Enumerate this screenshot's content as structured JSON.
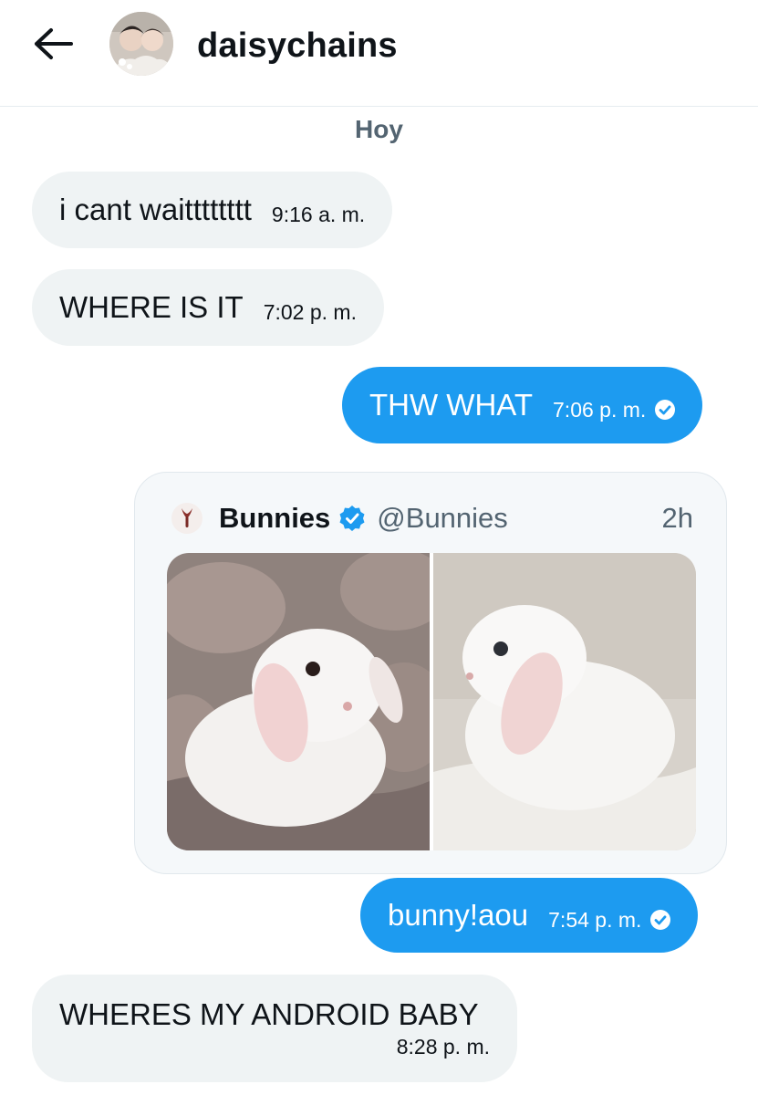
{
  "header": {
    "title": "daisychains",
    "back_icon": "arrow-left-icon"
  },
  "conversation": {
    "day_label": "Hoy",
    "messages": [
      {
        "text": "i cant waitttttttt",
        "time": "9:16 a. m.",
        "direction": "incoming"
      },
      {
        "text": "WHERE IS IT",
        "time": "7:02 p. m.",
        "direction": "incoming"
      },
      {
        "text": "THW WHAT",
        "time": "7:06 p. m.",
        "direction": "outgoing",
        "status_icon": "read-check-icon"
      },
      {
        "text": "bunny!aou",
        "time": "7:54 p. m.",
        "direction": "outgoing",
        "status_icon": "read-check-icon"
      },
      {
        "text": "WHERES MY ANDROID BABY",
        "time": "8:28 p. m.",
        "direction": "incoming"
      }
    ]
  },
  "quoted_post": {
    "name": "Bunnies",
    "handle": "@Bunnies",
    "age": "2h",
    "verified_icon": "verified-badge-icon",
    "photo_count": 2
  },
  "colors": {
    "outgoing_bubble": "#1d9bf0",
    "incoming_bubble": "#eff3f4",
    "secondary_text": "#536471",
    "divider": "#e6ecf0"
  }
}
